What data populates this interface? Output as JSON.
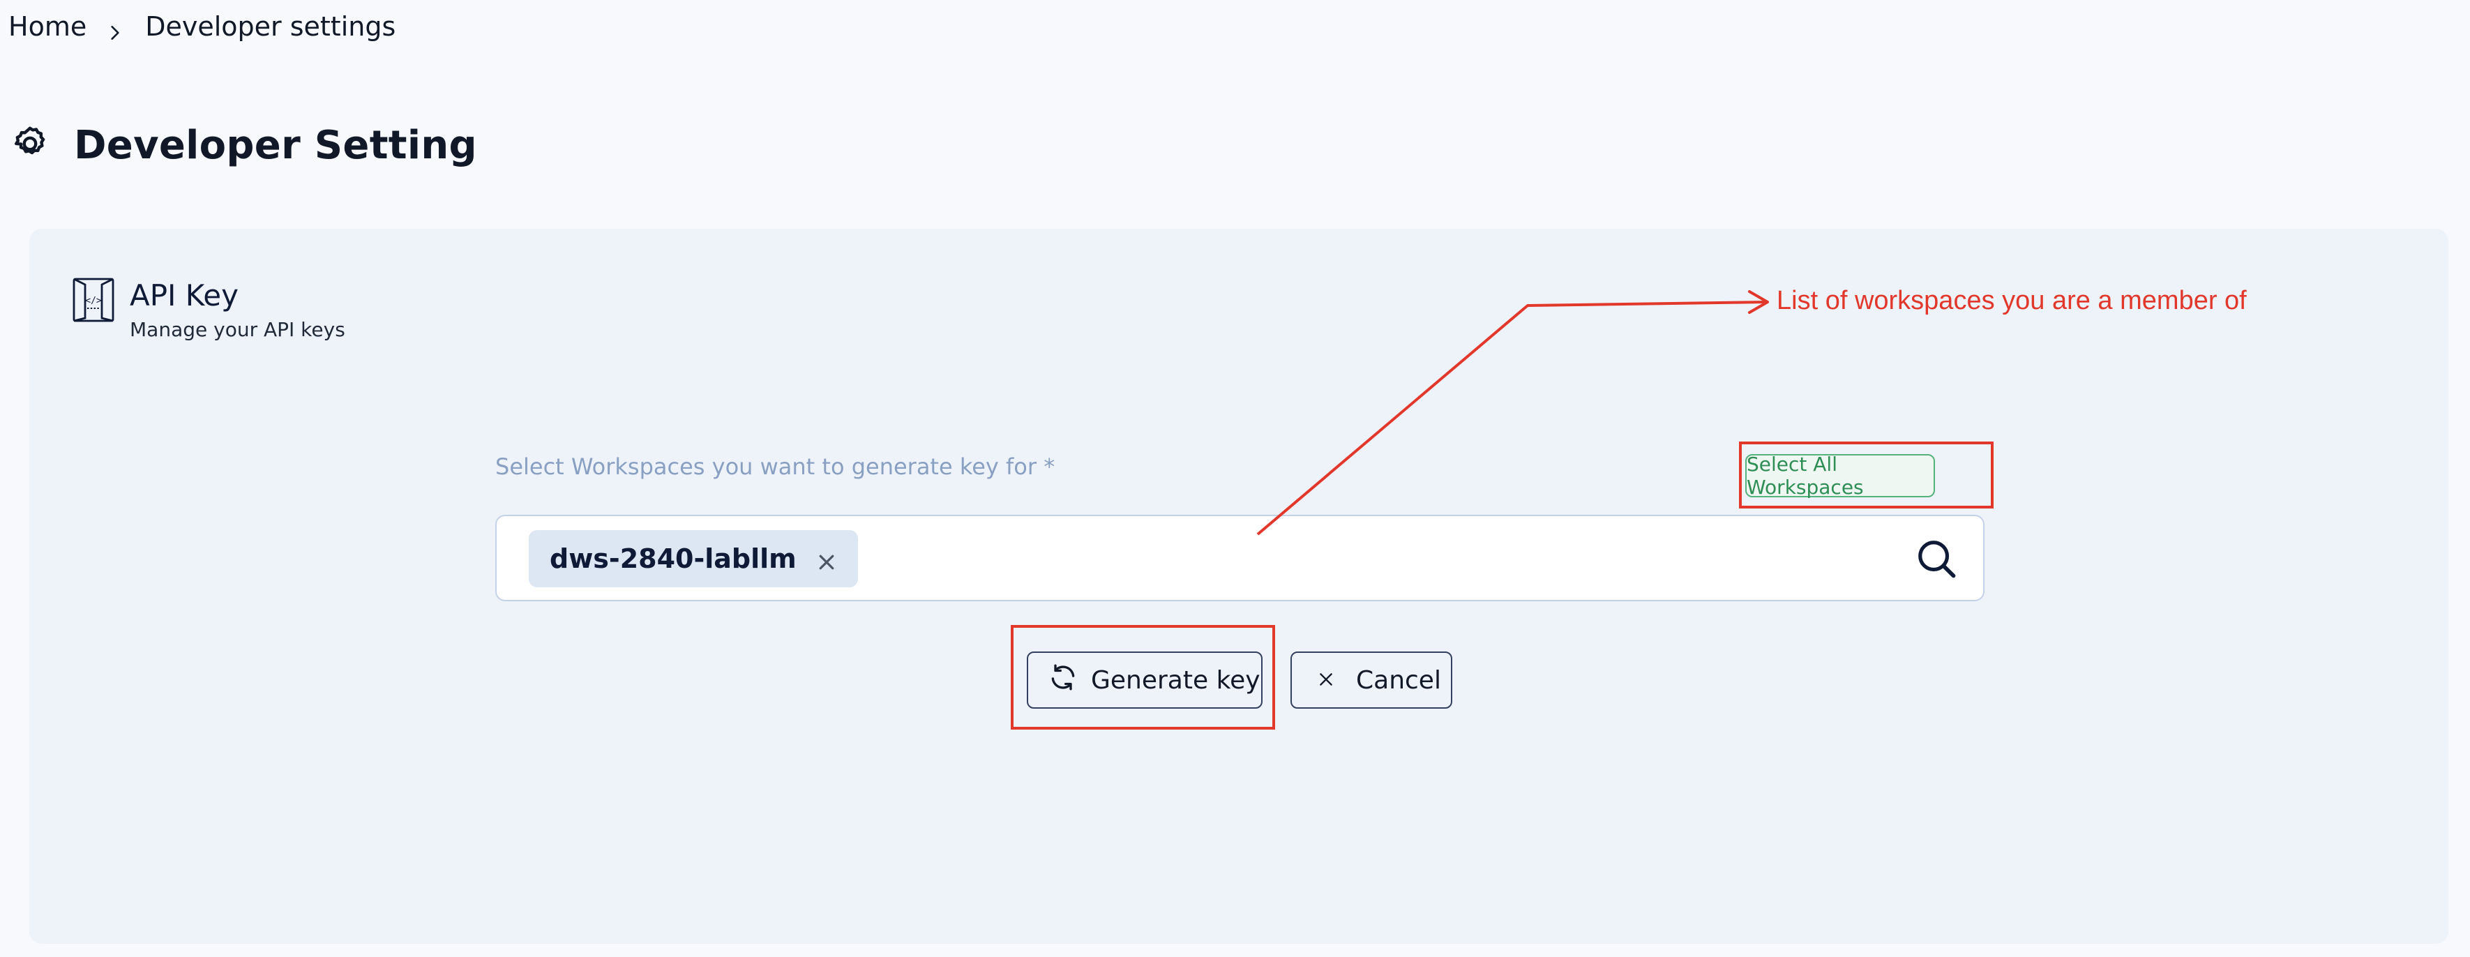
{
  "breadcrumb": {
    "home": "Home",
    "current": "Developer settings"
  },
  "page": {
    "title": "Developer Setting"
  },
  "api_key": {
    "title": "API Key",
    "subtitle": "Manage your API keys"
  },
  "workspaces": {
    "label": "Select Workspaces you want to generate key for *",
    "select_all_label": "Select All Workspaces",
    "selected": [
      {
        "label": "dws-2840-labllm"
      }
    ]
  },
  "actions": {
    "generate_label": "Generate key",
    "cancel_label": "Cancel"
  },
  "annotation": {
    "text": "List of workspaces you are a member of",
    "color": "#e2372b"
  },
  "colors": {
    "card_background": "#eef3fa",
    "success_green": "#2f8e56",
    "label_muted": "#8aa0c2"
  }
}
